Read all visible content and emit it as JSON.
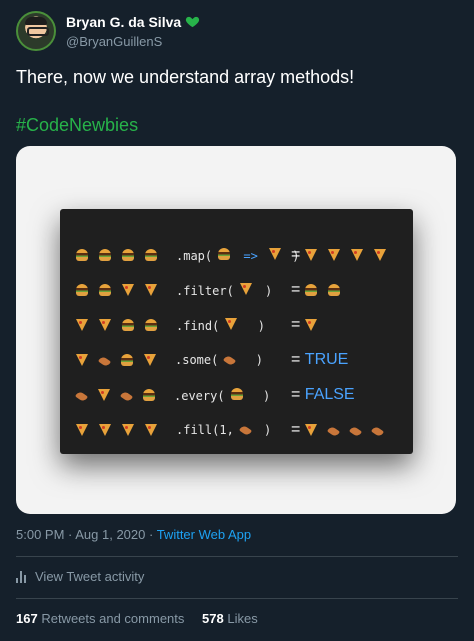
{
  "author": {
    "display_name": "Bryan G. da Silva",
    "handle": "@BryanGuillenS",
    "verified_heart_color": "#27b34a"
  },
  "tweet": {
    "text": "There, now we understand array methods!",
    "hashtag": "#CodeNewbies"
  },
  "media": {
    "rows": [
      {
        "icons": [
          "burger",
          "burger",
          "burger",
          "burger"
        ],
        "code": ".map(",
        "arg_icons": [
          "burger"
        ],
        "arrow": "=>",
        "arg2_icons": [
          "pizza"
        ],
        "close": " )",
        "result_icons": [
          "pizza",
          "pizza",
          "pizza",
          "pizza"
        ],
        "result_text": ""
      },
      {
        "icons": [
          "burger",
          "burger",
          "pizza",
          "pizza"
        ],
        "code": ".filter(",
        "arg_icons": [
          "pizza"
        ],
        "arrow": "",
        "arg2_icons": [],
        "close": " )",
        "result_icons": [
          "burger",
          "burger"
        ],
        "result_text": ""
      },
      {
        "icons": [
          "pizza",
          "pizza",
          "burger",
          "burger"
        ],
        "code": ".find(",
        "arg_icons": [
          "pizza"
        ],
        "arrow": "",
        "arg2_icons": [],
        "close": "  )",
        "result_icons": [
          "pizza"
        ],
        "result_text": ""
      },
      {
        "icons": [
          "pizza",
          "drum",
          "burger",
          "pizza"
        ],
        "code": ".some(",
        "arg_icons": [
          "drum"
        ],
        "arrow": "",
        "arg2_icons": [],
        "close": "  )",
        "result_icons": [],
        "result_text": "TRUE"
      },
      {
        "icons": [
          "drum",
          "pizza",
          "drum",
          "burger"
        ],
        "code": ".every(",
        "arg_icons": [
          "burger"
        ],
        "arrow": "",
        "arg2_icons": [],
        "close": "  )",
        "result_icons": [],
        "result_text": "FALSE"
      },
      {
        "icons": [
          "pizza",
          "pizza",
          "pizza",
          "pizza"
        ],
        "code": ".fill(1,",
        "arg_icons": [
          "drum"
        ],
        "arrow": "",
        "arg2_icons": [],
        "close": " )",
        "result_icons": [
          "pizza",
          "drum",
          "drum",
          "drum"
        ],
        "result_text": ""
      }
    ],
    "equals": "="
  },
  "meta": {
    "timestamp": "5:00 PM · Aug 1, 2020",
    "separator": " · ",
    "app": "Twitter Web App"
  },
  "activity": {
    "label": "View Tweet activity"
  },
  "stats": {
    "retweets_count": "167",
    "retweets_label": "Retweets and comments",
    "likes_count": "578",
    "likes_label": "Likes"
  }
}
